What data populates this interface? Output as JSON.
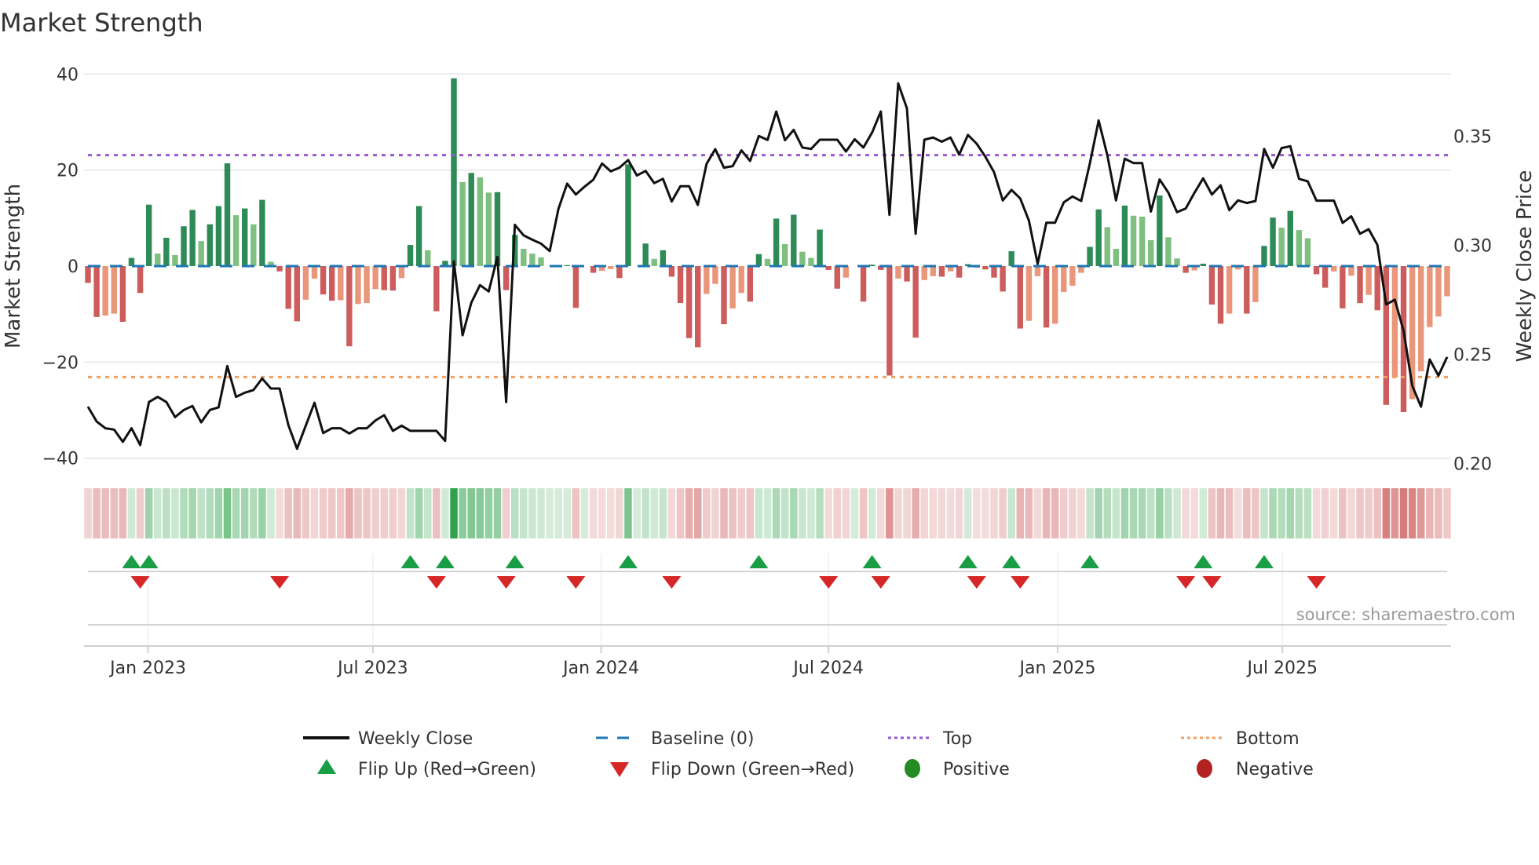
{
  "chart_data": {
    "type": "bar",
    "title": "Market Strength",
    "ylabel": "Market Strength",
    "y2label": "Weekly Close Price",
    "ylim": [
      -42.5,
      42.5
    ],
    "y2lim": [
      0.197,
      0.384
    ],
    "yticks": [
      {
        "value": 40,
        "label": "40"
      },
      {
        "value": 20,
        "label": "20"
      },
      {
        "value": 0,
        "label": "0"
      },
      {
        "value": -20,
        "label": "−20"
      },
      {
        "value": -40,
        "label": "−40"
      }
    ],
    "y2ticks": [
      {
        "value": 0.35,
        "label": "0.35"
      },
      {
        "value": 0.3,
        "label": "0.30"
      },
      {
        "value": 0.25,
        "label": "0.25"
      },
      {
        "value": 0.2,
        "label": "0.20"
      }
    ],
    "xunit": "week index",
    "xticks": [
      {
        "week": 6.9,
        "label": "Jan 2023"
      },
      {
        "week": 32.7,
        "label": "Jul 2023"
      },
      {
        "week": 58.9,
        "label": "Jan 2024"
      },
      {
        "week": 85.0,
        "label": "Jul 2024"
      },
      {
        "week": 111.3,
        "label": "Jan 2025"
      },
      {
        "week": 137.1,
        "label": "Jul 2025"
      }
    ],
    "thresholds": {
      "top": 23.1,
      "bottom": -23.1,
      "baseline": 0
    },
    "strength": [
      -3.5,
      -10.6,
      -10.3,
      -9.9,
      -11.6,
      1.7,
      -5.6,
      12.8,
      2.6,
      5.9,
      2.3,
      8.3,
      11.7,
      5.2,
      8.7,
      12.5,
      21.4,
      10.6,
      12.0,
      8.7,
      13.8,
      0.9,
      -1.1,
      -8.9,
      -11.5,
      -7.0,
      -2.6,
      -5.9,
      -7.2,
      -7.1,
      -16.7,
      -7.9,
      -7.7,
      -4.8,
      -5.0,
      -5.1,
      -2.5,
      4.4,
      12.5,
      3.3,
      -9.4,
      1.1,
      39.1,
      17.5,
      19.4,
      18.5,
      15.3,
      15.4,
      -5.0,
      6.5,
      3.6,
      2.6,
      1.8,
      0.0,
      0.0,
      0.2,
      -8.7,
      0.0,
      -1.4,
      -1.0,
      -0.6,
      -2.5,
      21.2,
      0.0,
      4.7,
      1.5,
      3.3,
      -2.2,
      -7.7,
      -15.0,
      -16.9,
      -5.8,
      -3.7,
      -12.1,
      -8.8,
      -5.6,
      -7.4,
      2.5,
      1.5,
      9.9,
      4.6,
      10.7,
      3.0,
      1.7,
      7.6,
      -0.8,
      -4.7,
      -2.4,
      0.0,
      -7.4,
      0.3,
      -0.8,
      -22.8,
      -2.6,
      -3.2,
      -14.9,
      -2.9,
      -2.1,
      -2.2,
      -1.1,
      -2.4,
      0.4,
      -0.3,
      -0.7,
      -2.4,
      -5.3,
      3.1,
      -13.0,
      -11.4,
      -2.1,
      -12.8,
      -12.0,
      -5.4,
      -4.1,
      -1.4,
      4.0,
      11.8,
      8.1,
      3.6,
      12.6,
      10.5,
      10.3,
      5.4,
      14.7,
      6.0,
      1.6,
      -1.4,
      -0.9,
      0.5,
      -8.0,
      -12.0,
      -9.9,
      -0.7,
      -9.9,
      -7.5,
      4.2,
      10.1,
      8.0,
      11.5,
      7.5,
      5.8,
      -1.7,
      -4.5,
      -1.1,
      -8.8,
      -2.0,
      -7.7,
      -6.0,
      -9.2,
      -28.9,
      -23.2,
      -30.4,
      -27.7,
      -21.9,
      -12.7,
      -10.5,
      -6.3
    ],
    "close": [
      0.2261,
      0.2193,
      0.2162,
      0.2156,
      0.21,
      0.2162,
      0.2085,
      0.2282,
      0.2306,
      0.2282,
      0.2213,
      0.2246,
      0.2264,
      0.2189,
      0.2246,
      0.2258,
      0.2447,
      0.2306,
      0.2325,
      0.2337,
      0.239,
      0.2344,
      0.2344,
      0.2177,
      0.2068,
      0.2174,
      0.2279,
      0.214,
      0.2162,
      0.2162,
      0.2138,
      0.2162,
      0.2162,
      0.2198,
      0.2222,
      0.215,
      0.2174,
      0.215,
      0.215,
      0.215,
      0.215,
      0.2104,
      0.2927,
      0.2588,
      0.2737,
      0.2818,
      0.2789,
      0.2947,
      0.2282,
      0.3094,
      0.3046,
      0.3026,
      0.3008,
      0.2974,
      0.3167,
      0.3283,
      0.3233,
      0.3269,
      0.3301,
      0.3375,
      0.3339,
      0.3356,
      0.3391,
      0.332,
      0.3341,
      0.3285,
      0.3305,
      0.3201,
      0.3271,
      0.3271,
      0.3185,
      0.3373,
      0.3441,
      0.3356,
      0.3363,
      0.3435,
      0.3387,
      0.3501,
      0.3483,
      0.3613,
      0.3482,
      0.3529,
      0.3448,
      0.3442,
      0.3484,
      0.3484,
      0.3484,
      0.343,
      0.3486,
      0.3448,
      0.3517,
      0.3613,
      0.314,
      0.3742,
      0.3628,
      0.3053,
      0.3484,
      0.3494,
      0.3475,
      0.3494,
      0.3416,
      0.3506,
      0.3466,
      0.3406,
      0.3335,
      0.3206,
      0.3254,
      0.3215,
      0.3113,
      0.2915,
      0.3104,
      0.3104,
      0.3197,
      0.3224,
      0.3203,
      0.3377,
      0.3572,
      0.3412,
      0.3206,
      0.3397,
      0.3377,
      0.3377,
      0.3155,
      0.3302,
      0.3242,
      0.3152,
      0.3169,
      0.3241,
      0.3307,
      0.3233,
      0.3275,
      0.3161,
      0.3206,
      0.3194,
      0.3203,
      0.3442,
      0.3356,
      0.3446,
      0.3454,
      0.3305,
      0.3293,
      0.3205,
      0.3205,
      0.3205,
      0.3103,
      0.3133,
      0.3053,
      0.3074,
      0.3002,
      0.2729,
      0.2751,
      0.2609,
      0.2357,
      0.2261,
      0.2477,
      0.2403,
      0.2489
    ],
    "flip_up_weeks": [
      5,
      7,
      37,
      41,
      49,
      62,
      77,
      90,
      101,
      106,
      115,
      128,
      135
    ],
    "flip_down_weeks": [
      6,
      22,
      40,
      48,
      56,
      67,
      85,
      91,
      102,
      107,
      126,
      129,
      141
    ],
    "legend": {
      "placement": "bottom",
      "entries": [
        {
          "label": "Weekly Close",
          "symbol": "line"
        },
        {
          "label": "Baseline (0)",
          "symbol": "dashed-line"
        },
        {
          "label": "Top",
          "symbol": "dotted-line"
        },
        {
          "label": "Bottom",
          "symbol": "dotted-line"
        },
        {
          "label": "Flip Up (Red→Green)",
          "symbol": "triangle-up"
        },
        {
          "label": "Flip Down (Green→Red)",
          "symbol": "triangle-down"
        },
        {
          "label": "Positive",
          "symbol": "circle"
        },
        {
          "label": "Negative",
          "symbol": "circle"
        }
      ]
    },
    "source": "source: sharemaestro.com"
  },
  "colors": {
    "pos_strong": "#2e8b57",
    "pos_weak": "#7fbf7f",
    "neg_strong": "#cd5c5c",
    "neg_weak": "#e9967a",
    "close_line": "#111111",
    "baseline": "#1f77b4",
    "top": "#9b59d0",
    "bottom": "#f0a060",
    "flip_up": "#1a9e45",
    "flip_down": "#d62728",
    "positive": "#228b22",
    "negative": "#b22222"
  }
}
